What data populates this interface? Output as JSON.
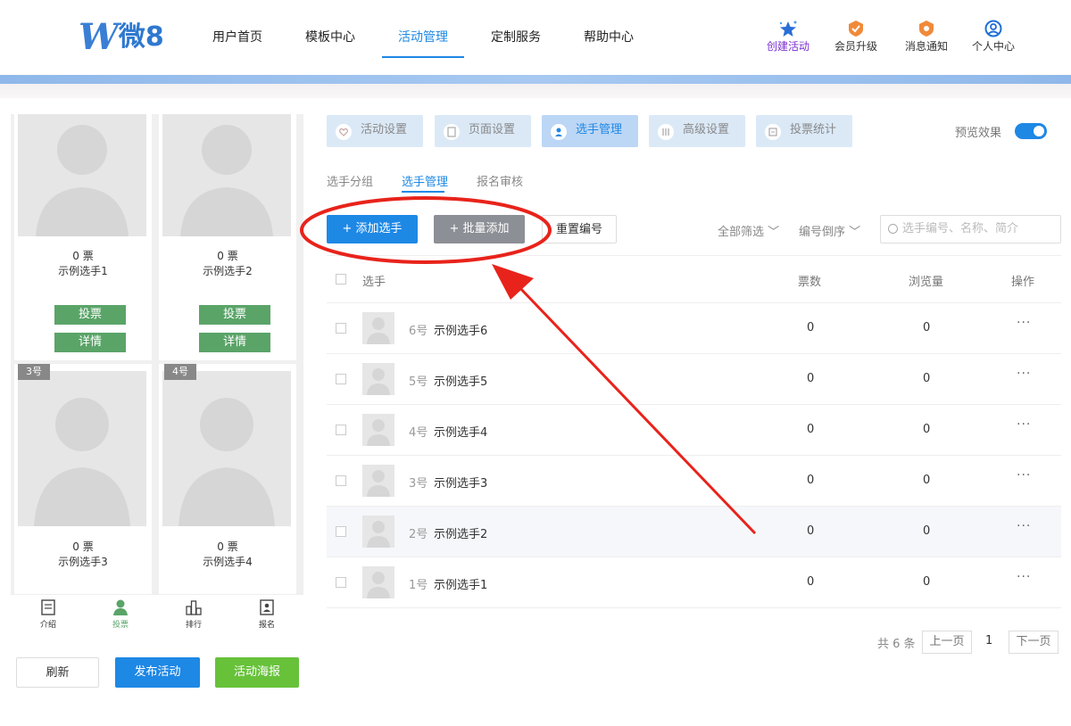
{
  "logo": {
    "mark": "W",
    "text": "微8"
  },
  "nav": {
    "items": [
      "用户首页",
      "模板中心",
      "活动管理",
      "定制服务",
      "帮助中心"
    ],
    "active": "活动管理"
  },
  "right_icons": [
    {
      "label": "创建活动",
      "icon": "star-icon"
    },
    {
      "label": "会员升级",
      "icon": "member-badge-icon"
    },
    {
      "label": "消息通知",
      "icon": "bell-badge-icon"
    },
    {
      "label": "个人中心",
      "icon": "user-circle-icon"
    }
  ],
  "preview": {
    "cards": [
      {
        "votes": "0 票",
        "name": "示例选手1",
        "vote_btn": "投票",
        "detail_btn": "详情"
      },
      {
        "votes": "0 票",
        "name": "示例选手2",
        "vote_btn": "投票",
        "detail_btn": "详情"
      },
      {
        "badge": "3号",
        "votes": "0 票",
        "name": "示例选手3"
      },
      {
        "badge": "4号",
        "votes": "0 票",
        "name": "示例选手4"
      }
    ],
    "bottom_tabs": [
      "介绍",
      "投票",
      "排行",
      "报名"
    ]
  },
  "left_buttons": {
    "refresh": "刷新",
    "publish": "发布活动",
    "poster": "活动海报"
  },
  "settings_tabs": [
    "活动设置",
    "页面设置",
    "选手管理",
    "高级设置",
    "投票统计"
  ],
  "preview_toggle": {
    "label": "预览效果",
    "on": true
  },
  "sub_tabs": [
    "选手分组",
    "选手管理",
    "报名审核"
  ],
  "actions": {
    "add": "+ 添加选手",
    "batch": "+ 批量添加",
    "reset": "重置编号",
    "filter_all": "全部筛选",
    "sort": "编号倒序",
    "search_placeholder": "选手编号、名称、简介"
  },
  "table": {
    "headers": {
      "player": "选手",
      "votes": "票数",
      "views": "浏览量",
      "ops": "操作"
    },
    "rows": [
      {
        "num": "6号",
        "name": "示例选手6",
        "votes": "0",
        "views": "0",
        "more": "···"
      },
      {
        "num": "5号",
        "name": "示例选手5",
        "votes": "0",
        "views": "0",
        "more": "···"
      },
      {
        "num": "4号",
        "name": "示例选手4",
        "votes": "0",
        "views": "0",
        "more": "···"
      },
      {
        "num": "3号",
        "name": "示例选手3",
        "votes": "0",
        "views": "0",
        "more": "···"
      },
      {
        "num": "2号",
        "name": "示例选手2",
        "votes": "0",
        "views": "0",
        "more": "···"
      },
      {
        "num": "1号",
        "name": "示例选手1",
        "votes": "0",
        "views": "0",
        "more": "···"
      }
    ]
  },
  "pager": {
    "total": "共 6 条",
    "prev": "上一页",
    "current": "1",
    "next": "下一页"
  },
  "colors": {
    "accent": "#1e88e5",
    "green": "#5aa468",
    "annotation": "#e8231b"
  }
}
